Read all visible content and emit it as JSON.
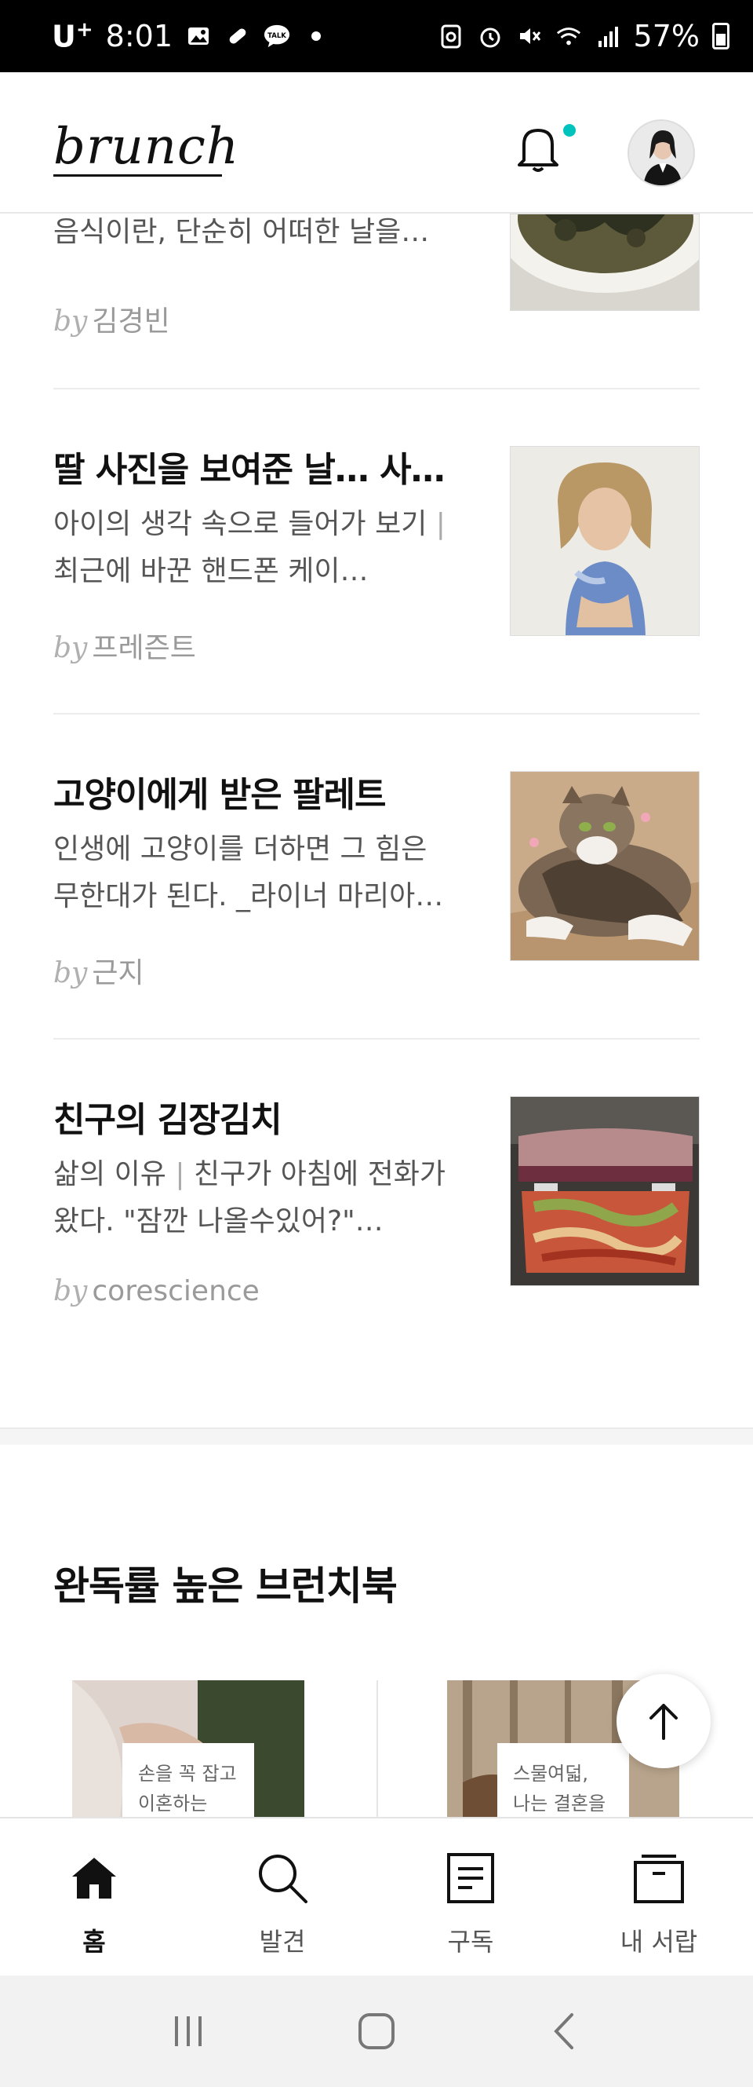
{
  "status_bar": {
    "carrier": "U",
    "carrier_sup": "+",
    "time": "8:01",
    "battery": "57%"
  },
  "header": {
    "logo": "brunch"
  },
  "articles": [
    {
      "title": "",
      "desc_main": "음식이란, 단순히 어떠한 날을…",
      "desc_tail": "",
      "author": "김경빈",
      "thumb": "seaweed-soup"
    },
    {
      "title": "딸 사진을 보여준 날… 사…",
      "desc_main": "아이의 생각 속으로 들어가 보기",
      "desc_tail": "최근에 바꾼 핸드폰 케이…",
      "author": "프레즌트",
      "thumb": "girl-portrait"
    },
    {
      "title": "고양이에게 받은 팔레트",
      "desc_main": "인생에 고양이를 더하면 그 힘은 무한대가 된다. _라이너 마리아…",
      "desc_tail": "",
      "author": "근지",
      "thumb": "tabby-cat"
    },
    {
      "title": "친구의 김장김치",
      "desc_main": "삶의 이유",
      "desc_tail": "친구가 아침에 전화가 왔다. \"잠깐 나올수있어?\"…",
      "author": "corescience",
      "thumb": "kimchi-container"
    }
  ],
  "by_label": "by",
  "section": {
    "title": "완독률 높은 브런치북",
    "books": [
      {
        "label_line1": "손을 꼭 잡고",
        "label_line2": "이혼하는"
      },
      {
        "label_line1": "스물여덟,",
        "label_line2": "나는 결혼을"
      }
    ]
  },
  "bottom_nav": [
    {
      "label": "홈",
      "icon": "home-icon",
      "active": true
    },
    {
      "label": "발견",
      "icon": "search-icon",
      "active": false
    },
    {
      "label": "구독",
      "icon": "document-icon",
      "active": false
    },
    {
      "label": "내 서랍",
      "icon": "drawer-icon",
      "active": false
    }
  ],
  "colors": {
    "accent": "#00c3bd",
    "text_primary": "#111111",
    "text_secondary": "#555555",
    "byline": "#9a9a9a"
  }
}
